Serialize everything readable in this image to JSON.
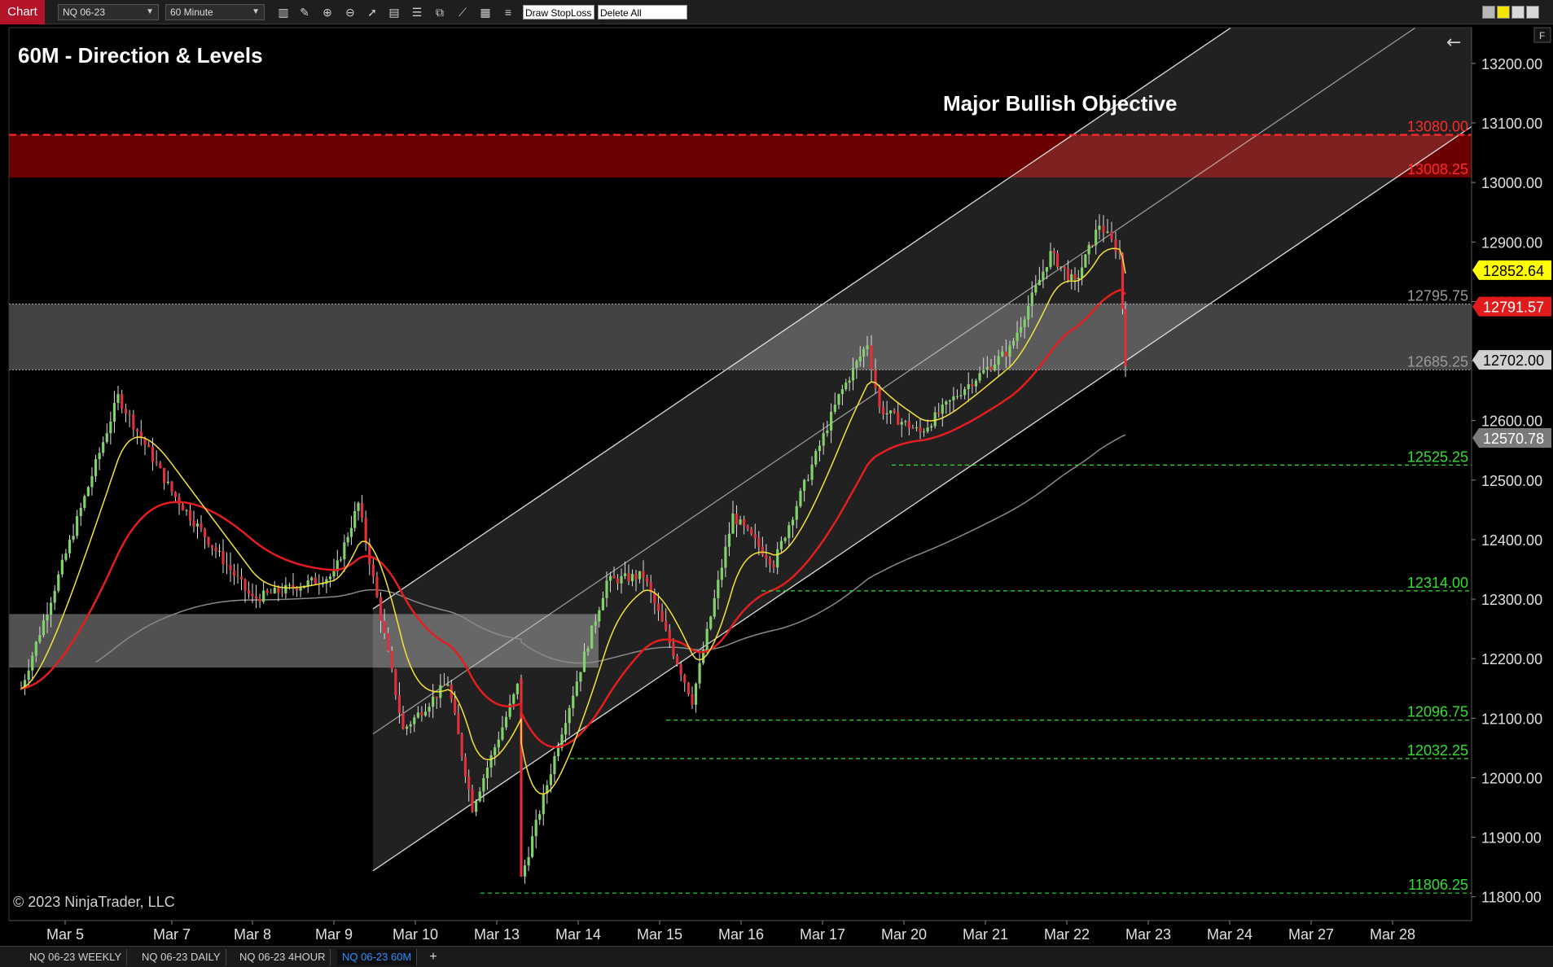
{
  "toolbar": {
    "chart_tab": "Chart",
    "instrument": "NQ 06-23",
    "interval": "60 Minute",
    "draw_stoploss": "Draw StopLoss",
    "delete_all_stoploss": "Delete All StopLoss"
  },
  "panel": {
    "back_arrow": "←",
    "corner_label": "F"
  },
  "tabs": [
    "NQ 06-23 WEEKLY",
    "NQ 06-23 DAILY",
    "NQ 06-23 4HOUR",
    "NQ 06-23 60M"
  ],
  "active_tab": 3,
  "colors": {
    "background": "#000000",
    "up_candle": "#7fd36a",
    "down_candle": "#e0303a",
    "ema_fast": "#f5e33a",
    "ema_slow": "#e41e1e",
    "sma_long": "#8a8a8a",
    "support_line": "#33dd33",
    "resistance_line": "#ff2a2a"
  },
  "chart_data": {
    "type": "candlestick",
    "title": "60M - Direction & Levels",
    "annotation": "Major Bullish Objective",
    "copyright": "© 2023 NinjaTrader, LLC",
    "y_ticks": [
      11800,
      11900,
      12000,
      12100,
      12200,
      12300,
      12400,
      12500,
      12600,
      12700,
      12800,
      12900,
      13000,
      13100,
      13200
    ],
    "ylim": [
      11760,
      13260
    ],
    "x_ticks": [
      "Mar 5",
      "Mar 7",
      "Mar 8",
      "Mar 9",
      "Mar 10",
      "Mar 13",
      "Mar 14",
      "Mar 15",
      "Mar 16",
      "Mar 17",
      "Mar 20",
      "Mar 21",
      "Mar 22",
      "Mar 23",
      "Mar 24",
      "Mar 27",
      "Mar 28"
    ],
    "zones": [
      {
        "name": "resistance",
        "from": 13008.25,
        "to": 13080.0,
        "color": "#6a0000"
      },
      {
        "name": "gray-upper",
        "from": 12685.25,
        "to": 12795.75,
        "color": "#4a4a4a"
      },
      {
        "name": "gray-lower",
        "from": 12185,
        "to": 12275,
        "color": "#5a5a5a",
        "x_range": [
          "Mar 5",
          "Mar 14"
        ]
      }
    ],
    "levels": [
      {
        "value": 13080.0,
        "label": "13080.00",
        "color": "#ff2a2a",
        "style": "dashed"
      },
      {
        "value": 13008.25,
        "label": "13008.25",
        "color": "#ff2a2a",
        "style": "none"
      },
      {
        "value": 12795.75,
        "label": "12795.75",
        "color": "#9a9a9a",
        "style": "dotted"
      },
      {
        "value": 12685.25,
        "label": "12685.25",
        "color": "#9a9a9a",
        "style": "dotted"
      },
      {
        "value": 12525.25,
        "label": "12525.25",
        "color": "#33dd33",
        "style": "dashed"
      },
      {
        "value": 12314.0,
        "label": "12314.00",
        "color": "#33dd33",
        "style": "dashed"
      },
      {
        "value": 12096.75,
        "label": "12096.75",
        "color": "#33dd33",
        "style": "dashed"
      },
      {
        "value": 12032.25,
        "label": "12032.25",
        "color": "#33dd33",
        "style": "dashed"
      },
      {
        "value": 11806.25,
        "label": "11806.25",
        "color": "#33dd33",
        "style": "dashed"
      }
    ],
    "price_markers": [
      {
        "value": 12852.64,
        "label": "12852.64",
        "bg": "#ffff00",
        "fg": "#000000"
      },
      {
        "value": 12791.57,
        "label": "12791.57",
        "bg": "#e11b1b",
        "fg": "#ffffff"
      },
      {
        "value": 12702.0,
        "label": "12702.00",
        "bg": "#d0d0d0",
        "fg": "#000000"
      },
      {
        "value": 12570.78,
        "label": "12570.78",
        "bg": "#7a7a7a",
        "fg": "#ffffff"
      }
    ],
    "channel": {
      "lower": [
        [
          "Mar 10",
          11890
        ],
        [
          "Mar 22",
          12700
        ]
      ],
      "upper_offset": 440,
      "mid_offset": 230
    },
    "key_points": [
      [
        "Mar 5",
        12150
      ],
      [
        "Mar 6",
        12640
      ],
      [
        "Mar 7",
        12480
      ],
      [
        "Mar 8",
        12300
      ],
      [
        "Mar 9",
        12340
      ],
      [
        "Mar 9",
        12460
      ],
      [
        "Mar 10",
        12080
      ],
      [
        "Mar 10",
        12160
      ],
      [
        "Mar 13",
        11950
      ],
      [
        "Mar 13",
        12170
      ],
      [
        "Mar 13",
        11830
      ],
      [
        "Mar 14",
        12080
      ],
      [
        "Mar 14",
        12330
      ],
      [
        "Mar 15",
        12340
      ],
      [
        "Mar 15",
        12130
      ],
      [
        "Mar 16",
        12440
      ],
      [
        "Mar 16",
        12360
      ],
      [
        "Mar 17",
        12640
      ],
      [
        "Mar 17",
        12730
      ],
      [
        "Mar 20",
        12620
      ],
      [
        "Mar 20",
        12580
      ],
      [
        "Mar 21",
        12650
      ],
      [
        "Mar 21",
        12720
      ],
      [
        "Mar 22",
        12880
      ],
      [
        "Mar 22",
        12830
      ],
      [
        "Mar 22",
        12930
      ],
      [
        "Mar 22",
        12880
      ],
      [
        "Mar 22",
        12700
      ]
    ]
  }
}
